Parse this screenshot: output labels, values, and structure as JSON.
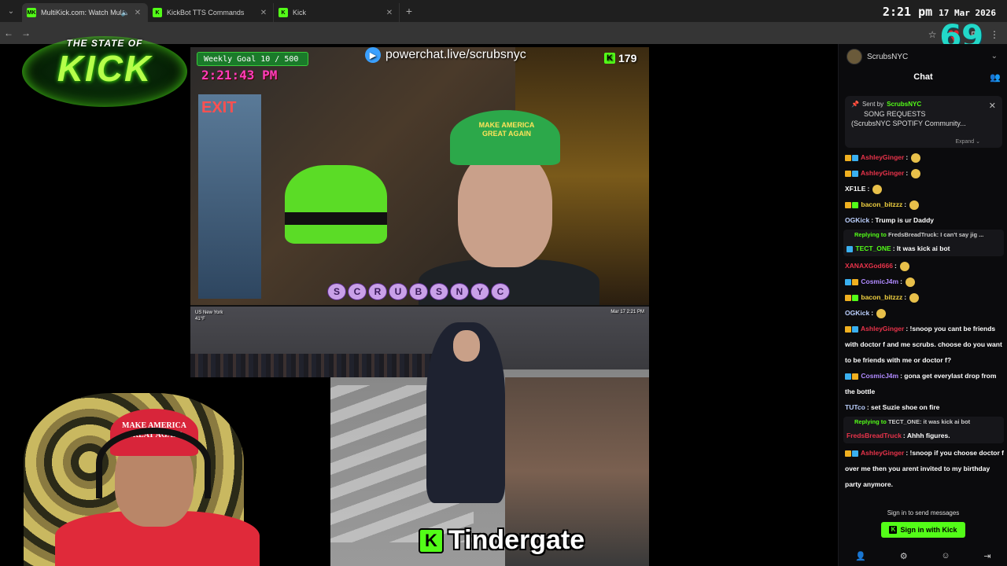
{
  "browser": {
    "tabs": [
      {
        "title": "MultiKick.com: Watch Multi",
        "favicon": "MK"
      },
      {
        "title": "KickBot TTS Commands",
        "favicon": "K"
      },
      {
        "title": "Kick",
        "favicon": "K"
      }
    ],
    "clock_time": "2:21 pm",
    "clock_date": "17 Mar 2026"
  },
  "overlay": {
    "logo_top": "THE STATE OF",
    "logo_main": "KICK",
    "heart_count": "69"
  },
  "stream": {
    "weekly_goal": "Weekly Goal 10 / 500",
    "timer": "2:21:43 PM",
    "powerchat": "powerchat.live/scrubsnyc",
    "viewers": "179",
    "name_letters": [
      "S",
      "C",
      "R",
      "U",
      "B",
      "S",
      "N",
      "Y",
      "C"
    ],
    "cap_text": "MAKE AMERICA GREAT AGAIN",
    "exit_sign": "EXIT",
    "location_tag": "US New York",
    "temp_tag": "41°F",
    "date_tag": "Mar 17 2:21 PM",
    "subtitle": "Tindergate"
  },
  "webcam": {
    "cap_text": "MAKE AMERICA GREAT AGAIN"
  },
  "chat": {
    "channel": "ScrubsNYC",
    "title": "Chat",
    "pinned": {
      "sent_by_label": "Sent by",
      "sender": "ScrubsNYC",
      "line1": "SONG REQUESTS",
      "line2": "(ScrubsNYC SPOTIFY Community...",
      "expand": "Expand"
    },
    "messages": [
      {
        "user": "AshleyGinger",
        "color": "#e8334a",
        "text": ""
      },
      {
        "user": "AshleyGinger",
        "color": "#e8334a",
        "text": ""
      },
      {
        "user": "XF1LE",
        "color": "#ffffff",
        "text": ""
      },
      {
        "user": "bacon_bitzzz",
        "color": "#f0d040",
        "text": ""
      },
      {
        "user": "OGKick",
        "color": "#bcd0ff",
        "text": "Trump is ur Daddy"
      },
      {
        "user": "XANAXGod666",
        "color": "#e8334a",
        "text": ""
      },
      {
        "user": "CosmicJ4m",
        "color": "#b08aff",
        "text": ""
      },
      {
        "user": "bacon_bitzzz",
        "color": "#f0d040",
        "text": ""
      },
      {
        "user": "OGKick",
        "color": "#bcd0ff",
        "text": ""
      },
      {
        "user": "AshleyGinger",
        "color": "#e8334a",
        "text": "!snoop you cant be friends with doctor f and me scrubs. choose do you want to be friends with me or doctor f?"
      },
      {
        "user": "CosmicJ4m",
        "color": "#b08aff",
        "text": "gona get everylast drop from the bottle"
      },
      {
        "user": "TUTco",
        "color": "#bcd0ff",
        "text": "set Suzie shoe on fire"
      },
      {
        "user": "AshleyGinger",
        "color": "#e8334a",
        "text": "!snoop if you choose doctor f over me then you arent invited to my birthday party anymore."
      }
    ],
    "reply1": {
      "label": "Replying to",
      "target": "FredsBreadTruck:",
      "snippet": "I can't say jig ...",
      "user": "TECT_ONE",
      "text": "It was kick ai bot"
    },
    "reply2": {
      "label": "Replying to",
      "target": "TECT_ONE:",
      "snippet": "it was kick ai bot",
      "user": "FredsBreadTruck",
      "text": "Ahhh figures."
    },
    "signin_label": "Sign in to send messages",
    "signin_button": "Sign in with Kick",
    "accent": "#53fc18"
  }
}
